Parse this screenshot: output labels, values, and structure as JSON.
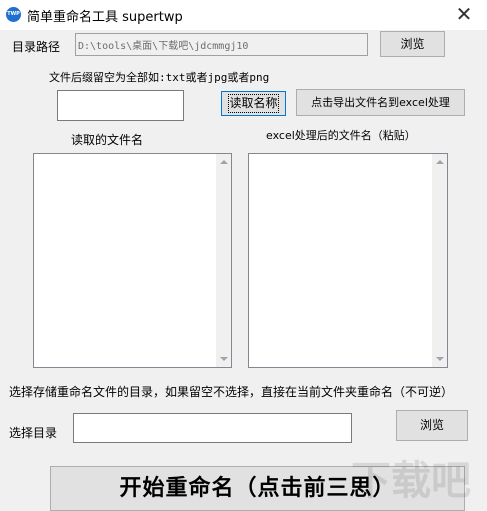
{
  "window": {
    "title": "简单重命名工具 supertwp",
    "close_glyph": "✕",
    "icon_text": "TWP"
  },
  "dir_path": {
    "label": "目录路径",
    "value": "D:\\tools\\桌面\\下载吧\\jdcmmgj10",
    "browse_label": "浏览"
  },
  "suffix": {
    "hint": "文件后缀留空为全部如:txt或者jpg或者png",
    "value": ""
  },
  "buttons": {
    "read_names": "读取名称",
    "export_excel": "点击导出文件名到excel处理"
  },
  "lists": {
    "read_title": "读取的文件名",
    "excel_title": "excel处理后的文件名（粘贴）"
  },
  "save_dir": {
    "hint": "选择存储重命名文件的目录，如果留空不选择，直接在当前文件夹重命名（不可逆）",
    "label": "选择目录",
    "value": "",
    "browse_label": "浏览"
  },
  "start_button": "开始重命名（点击前三思）",
  "watermark": "下载吧"
}
